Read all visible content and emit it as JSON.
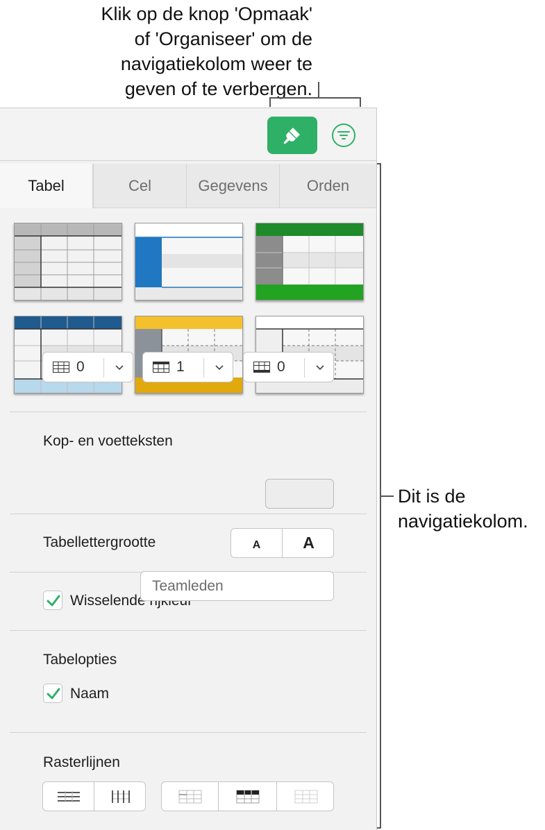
{
  "callouts": {
    "top": [
      "Klik op de knop 'Opmaak'",
      "of 'Organiseer' om de",
      "navigatiekolom weer te",
      "geven of te verbergen."
    ],
    "side": [
      "Dit is de",
      "navigatiekolom."
    ]
  },
  "toolbar": {
    "format_icon": "paintbrush-icon",
    "organize_icon": "filter-list-icon",
    "accent_color": "#2eb067"
  },
  "tabs": [
    {
      "label": "Tabel",
      "active": true
    },
    {
      "label": "Cel",
      "active": false
    },
    {
      "label": "Gegevens",
      "active": false
    },
    {
      "label": "Orden",
      "active": false
    }
  ],
  "table_styles": [
    {
      "name": "gray",
      "header": "#b8b8b8"
    },
    {
      "name": "blue-sidebar",
      "header": "#ffffff",
      "accent": "#1f78c1"
    },
    {
      "name": "green",
      "header": "#1f8a2a",
      "accent": "#22a322"
    },
    {
      "name": "navy",
      "header": "#1f5b8e",
      "footer": "#b8d8ec"
    },
    {
      "name": "yellow",
      "header": "#f4c02b",
      "footer": "#e2a90e"
    },
    {
      "name": "plain",
      "header": "#ffffff"
    }
  ],
  "headers_footers": {
    "title": "Kop- en voetteksten",
    "header_rows": "0",
    "header_columns": "1",
    "footer_rows": "0"
  },
  "font_size": {
    "label": "Tabellettergrootte",
    "smaller": "A",
    "larger": "A"
  },
  "alternating_rows": {
    "label": "Wisselende rijkleur",
    "checked": true,
    "color": "#ededed"
  },
  "table_options": {
    "title": "Tabelopties",
    "name_label": "Naam",
    "name_checked": true,
    "name_value": "Teamleden"
  },
  "gridlines": {
    "title": "Rasterlijnen"
  }
}
